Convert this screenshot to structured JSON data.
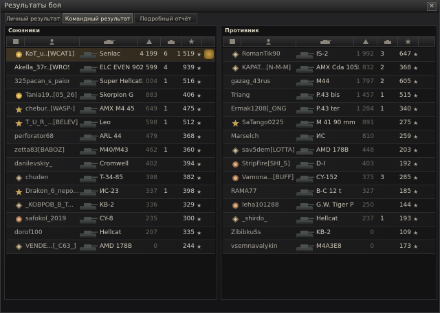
{
  "window": {
    "title": "Результаты боя",
    "close_label": "×"
  },
  "tabs": [
    {
      "label": "Личный результат",
      "active": false
    },
    {
      "label": "Командный результат",
      "active": true
    },
    {
      "label": "Подробный отчёт",
      "active": false
    }
  ],
  "allies": {
    "title": "Союзники",
    "players": [
      {
        "name": "KoT_u..[WCAT1]",
        "tank": "Senlac",
        "damage": "4 199",
        "kills": "6",
        "xp": "1 519",
        "medal": "gold",
        "highlight": true,
        "achievement": true
      },
      {
        "name": "Akella_37r..[WROSE]",
        "tank": "ELC EVEN 90",
        "damage": "2 599",
        "kills": "4",
        "xp": "939",
        "medal": "none",
        "light": true
      },
      {
        "name": "325pacan_s_paiona",
        "tank": "Super Hellcat",
        "damage": "1 004",
        "kills": "1",
        "xp": "516",
        "medal": "none"
      },
      {
        "name": "Tania19..[05_26]",
        "tank": "Skorpion G",
        "damage": "883",
        "kills": "",
        "xp": "406",
        "medal": "gold"
      },
      {
        "name": "chebur..[WASP-]",
        "tank": "AMX M4 45",
        "damage": "649",
        "kills": "1",
        "xp": "475",
        "medal": "star"
      },
      {
        "name": "T_U_R_...[BELEV]",
        "tank": "Leo",
        "damage": "598",
        "kills": "1",
        "xp": "512",
        "medal": "star"
      },
      {
        "name": "perforator68",
        "tank": "ARL 44",
        "damage": "479",
        "kills": "",
        "xp": "368",
        "medal": "none"
      },
      {
        "name": "zetta83[BABOZ]",
        "tank": "M40/M43",
        "damage": "462",
        "kills": "1",
        "xp": "360",
        "medal": "none"
      },
      {
        "name": "danilevskiy_",
        "tank": "Cromwell",
        "damage": "402",
        "kills": "",
        "xp": "394",
        "medal": "none"
      },
      {
        "name": "chuden",
        "tank": "T-34-85",
        "damage": "398",
        "kills": "",
        "xp": "382",
        "medal": "diamond"
      },
      {
        "name": "Drakon_6_nepo...",
        "tank": "ИС-23",
        "damage": "337",
        "kills": "1",
        "xp": "398",
        "medal": "star"
      },
      {
        "name": "_KOBPOB_B_T...",
        "tank": "KB-2",
        "damage": "336",
        "kills": "",
        "xp": "329",
        "medal": "diamond"
      },
      {
        "name": "safokol_2019",
        "tank": "CY-8",
        "damage": "235",
        "kills": "",
        "xp": "300",
        "medal": "ring"
      },
      {
        "name": "dorof100",
        "tank": "Hellcat",
        "damage": "207",
        "kills": "",
        "xp": "335",
        "medal": "none"
      },
      {
        "name": "VENDE...[_C63_]",
        "tank": "AMD 178B",
        "damage": "0",
        "kills": "",
        "xp": "244",
        "medal": "diamond"
      }
    ]
  },
  "enemies": {
    "title": "Противник",
    "players": [
      {
        "name": "RomanTik90",
        "tank": "IS-2",
        "damage": "1 992",
        "kills": "3",
        "xp": "647",
        "medal": "diamond"
      },
      {
        "name": "KAPAT...[N-M-M]",
        "tank": "AMX Cda 105",
        "damage": "1 832",
        "kills": "2",
        "xp": "368",
        "medal": "diamond"
      },
      {
        "name": "gazag_43rus",
        "tank": "M44",
        "damage": "1 797",
        "kills": "2",
        "xp": "605",
        "medal": "none"
      },
      {
        "name": "Triang",
        "tank": "P.43 bis",
        "damage": "1 457",
        "kills": "1",
        "xp": "515",
        "medal": "none"
      },
      {
        "name": "Ermak1208[_ONG_]",
        "tank": "P.43 ter",
        "damage": "1 284",
        "kills": "1",
        "xp": "340",
        "medal": "none"
      },
      {
        "name": "SaTango0225",
        "tank": "M 41 90 mm",
        "damage": "891",
        "kills": "",
        "xp": "275",
        "medal": "star"
      },
      {
        "name": "Marselch",
        "tank": "ИС",
        "damage": "810",
        "kills": "",
        "xp": "259",
        "medal": "none"
      },
      {
        "name": "sav5dem[LOTTA]",
        "tank": "AMD 178B",
        "damage": "448",
        "kills": "",
        "xp": "203",
        "medal": "diamond"
      },
      {
        "name": "StripFire[SHI_S]",
        "tank": "D-I",
        "damage": "403",
        "kills": "",
        "xp": "192",
        "medal": "ring"
      },
      {
        "name": "Vamona...[BUFF]",
        "tank": "CY-152",
        "damage": "375",
        "kills": "3",
        "xp": "285",
        "medal": "ring"
      },
      {
        "name": "RAMA77",
        "tank": "B-C 12 t",
        "damage": "327",
        "kills": "",
        "xp": "185",
        "medal": "none"
      },
      {
        "name": "leha101288",
        "tank": "G.W. Tiger P",
        "damage": "250",
        "kills": "",
        "xp": "144",
        "medal": "ring"
      },
      {
        "name": "_shirdo_",
        "tank": "Hellcat",
        "damage": "237",
        "kills": "1",
        "xp": "193",
        "medal": "diamond"
      },
      {
        "name": "ZibibkuSs",
        "tank": "KB-2",
        "damage": "0",
        "kills": "",
        "xp": "109",
        "medal": "none"
      },
      {
        "name": "vsemnavalykin",
        "tank": "M4A3E8",
        "damage": "0",
        "kills": "",
        "xp": "173",
        "medal": "none"
      }
    ]
  },
  "icons": {
    "medal": "medal-icon",
    "player": "player-icon",
    "vehicle": "vehicle-icon",
    "damage": "damage-icon",
    "kills": "kills-icon",
    "experience": "experience-star-icon",
    "achievement": "achievement-icon"
  },
  "colors": {
    "highlight_row": "#3e3424",
    "gold": "#d4a94a",
    "text": "#cdc7b9"
  }
}
